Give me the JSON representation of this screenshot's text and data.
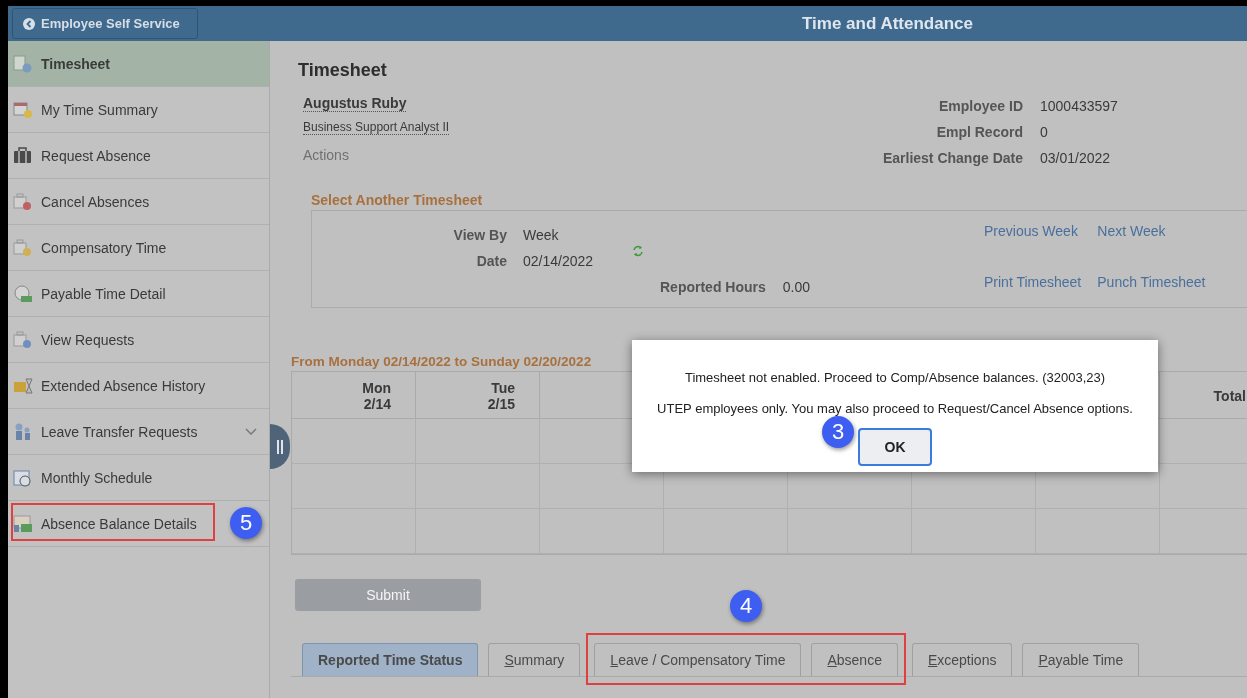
{
  "header": {
    "back_button": "Employee Self Service",
    "title": "Time and Attendance"
  },
  "sidebar": {
    "items": [
      {
        "label": "Timesheet",
        "selected": true,
        "kind": "timesheet"
      },
      {
        "label": "My Time Summary",
        "selected": false,
        "kind": "calendar"
      },
      {
        "label": "Request Absence",
        "selected": false,
        "kind": "briefcase"
      },
      {
        "label": "Cancel Absences",
        "selected": false,
        "kind": "cancel"
      },
      {
        "label": "Compensatory Time",
        "selected": false,
        "kind": "comp"
      },
      {
        "label": "Payable Time Detail",
        "selected": false,
        "kind": "payable"
      },
      {
        "label": "View Requests",
        "selected": false,
        "kind": "view"
      },
      {
        "label": "Extended Absence History",
        "selected": false,
        "kind": "history"
      },
      {
        "label": "Leave Transfer Requests",
        "selected": false,
        "kind": "people",
        "expandable": true
      },
      {
        "label": "Monthly Schedule",
        "selected": false,
        "kind": "schedule"
      },
      {
        "label": "Absence Balance Details",
        "selected": false,
        "kind": "chart",
        "highlighted": true,
        "callout": "5"
      }
    ]
  },
  "page": {
    "title": "Timesheet",
    "employee_name": "Augustus Ruby",
    "job_title": "Business Support Analyst II",
    "actions": "Actions",
    "fields": [
      {
        "label": "Employee ID",
        "value": "1000433597"
      },
      {
        "label": "Empl Record",
        "value": "0"
      },
      {
        "label": "Earliest Change Date",
        "value": "03/01/2022"
      }
    ]
  },
  "select_timesheet": {
    "title": "Select Another Timesheet",
    "view_by": {
      "label": "View By",
      "value": "Week"
    },
    "date": {
      "label": "Date",
      "value": "02/14/2022"
    },
    "reported_hours": {
      "label": "Reported Hours",
      "value": "0.00"
    },
    "links": [
      "Previous Week",
      "Next Week",
      "Print Timesheet",
      "Punch Timesheet"
    ]
  },
  "grid": {
    "range": "From Monday 02/14/2022 to Sunday 02/20/2022",
    "columns": [
      {
        "day": "Mon",
        "date": "2/14"
      },
      {
        "day": "Tue",
        "date": "2/15"
      }
    ],
    "total": "Total"
  },
  "submit": {
    "label": "Submit",
    "disabled": true
  },
  "tab_groups": [
    {
      "highlighted": false,
      "tabs": [
        {
          "label": "Reported Time Status",
          "selected": true,
          "accesskey": false
        },
        {
          "label": "Summary",
          "selected": false,
          "accesskey": true
        }
      ]
    },
    {
      "highlighted": true,
      "callout": "4",
      "tabs": [
        {
          "label": "Leave / Compensatory Time",
          "selected": false,
          "accesskey": true
        },
        {
          "label": "Absence",
          "selected": false,
          "accesskey": true
        }
      ]
    },
    {
      "highlighted": false,
      "tabs": [
        {
          "label": "Exceptions",
          "selected": false,
          "accesskey": true
        },
        {
          "label": "Payable Time",
          "selected": false,
          "accesskey": true
        }
      ]
    }
  ],
  "dialog": {
    "messages": [
      "Timesheet not enabled. Proceed to Comp/Absence balances. (32003,23)",
      "UTEP employees only. You may also proceed to Request/Cancel Absence options."
    ],
    "ok_button": "OK",
    "callout": "3"
  }
}
